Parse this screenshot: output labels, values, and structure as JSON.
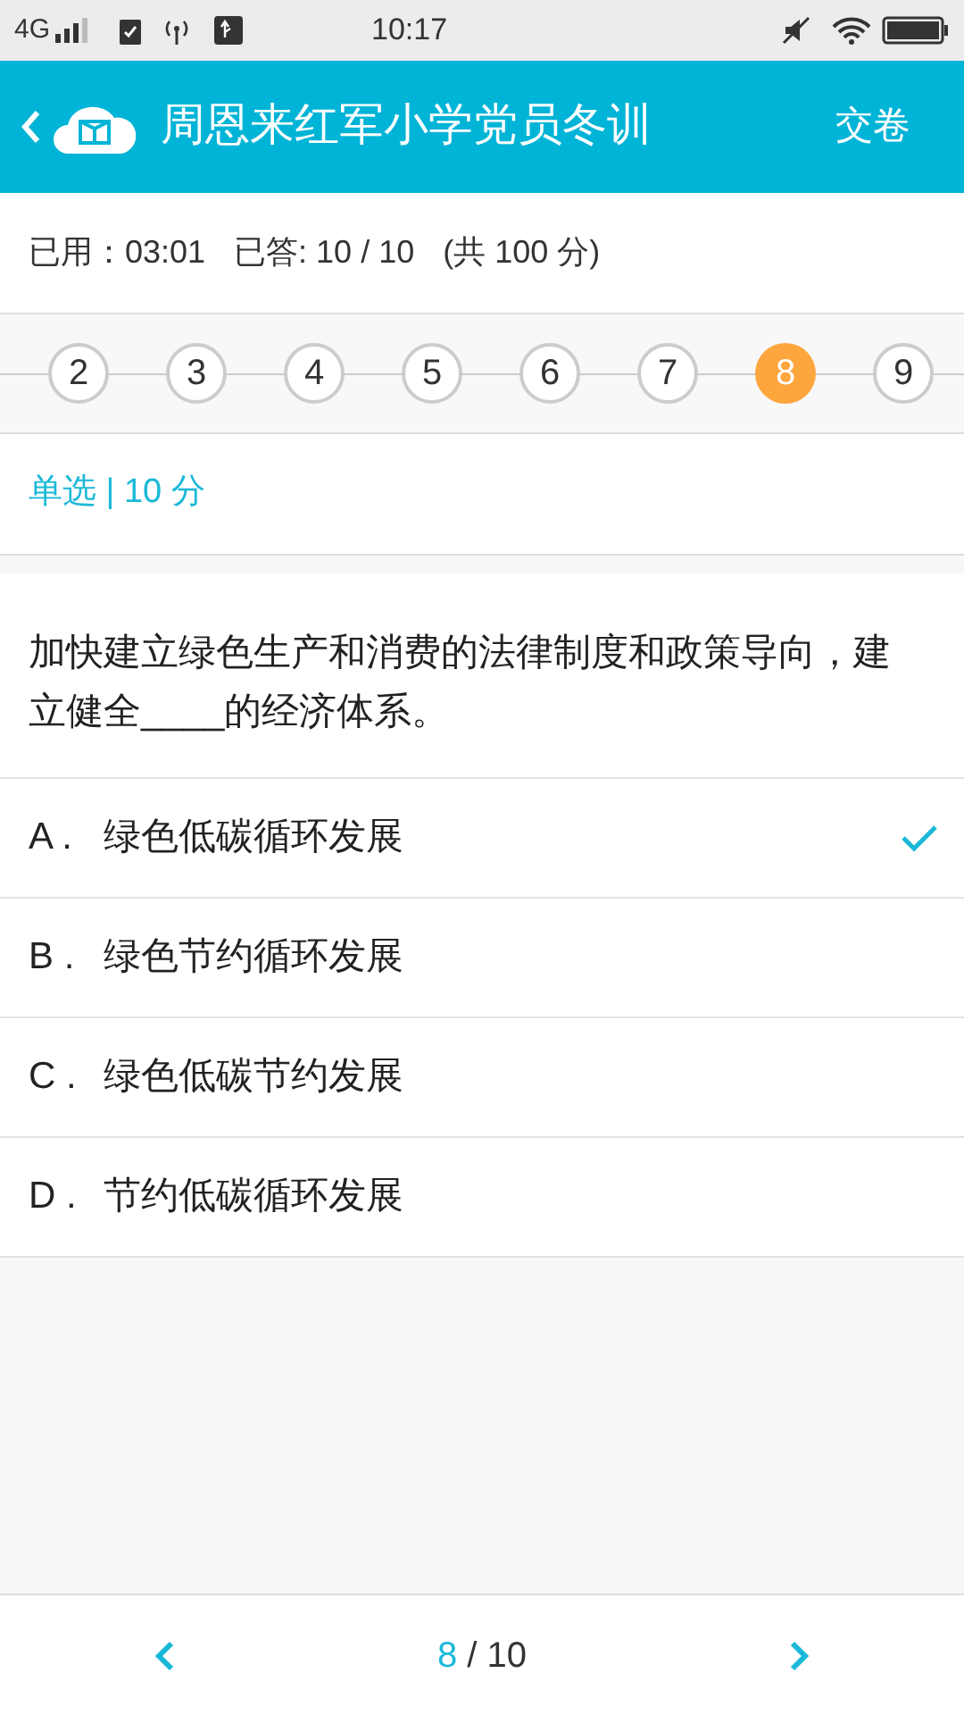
{
  "status_bar": {
    "network": "4G",
    "time": "10:17"
  },
  "header": {
    "title": "周恩来红军小学党员冬训",
    "action": "交卷"
  },
  "info": {
    "elapsed": "已用：03:01",
    "answered": "已答: 10 / 10",
    "total": "(共 100 分)"
  },
  "question_nav": [
    {
      "label": "2",
      "selected": false
    },
    {
      "label": "3",
      "selected": false
    },
    {
      "label": "4",
      "selected": false
    },
    {
      "label": "5",
      "selected": false
    },
    {
      "label": "6",
      "selected": false
    },
    {
      "label": "7",
      "selected": false
    },
    {
      "label": "8",
      "selected": true
    },
    {
      "label": "9",
      "selected": false
    }
  ],
  "question": {
    "type": "单选 | 10 分",
    "text": "加快建立绿色生产和消费的法律制度和政策导向，建立健全____的经济体系。"
  },
  "options": [
    {
      "letter": "A .",
      "text": "绿色低碳循环发展",
      "selected": true
    },
    {
      "letter": "B .",
      "text": "绿色节约循环发展",
      "selected": false
    },
    {
      "letter": "C .",
      "text": "绿色低碳节约发展",
      "selected": false
    },
    {
      "letter": "D .",
      "text": "节约低碳循环发展",
      "selected": false
    }
  ],
  "footer": {
    "current": "8",
    "rest": "/ 10"
  }
}
